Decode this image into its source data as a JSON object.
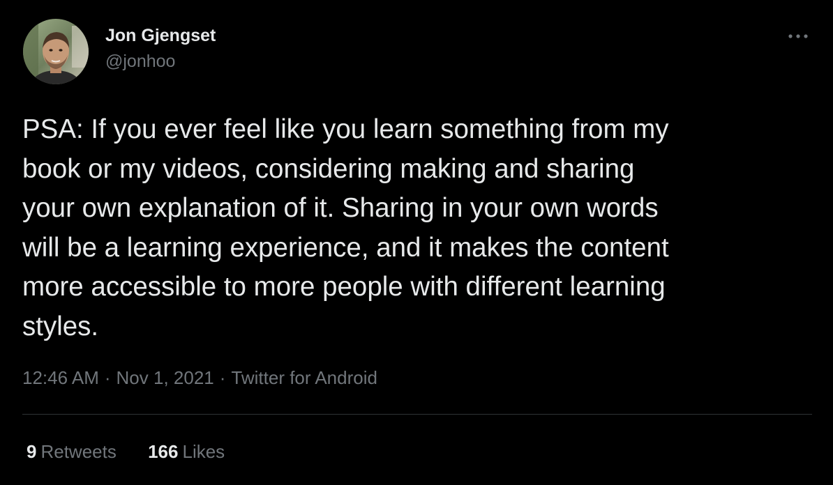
{
  "author": {
    "display_name": "Jon Gjengset",
    "handle": "@jonhoo",
    "avatar_icon": "profile-photo"
  },
  "more_icon": "ellipsis-icon",
  "tweet": {
    "text": "PSA: If you ever feel like you learn something from my\nbook or my videos, considering making and sharing\nyour own explanation of it. Sharing in your own words\nwill be a learning experience, and it makes the content\nmore accessible to more people with different learning\nstyles."
  },
  "meta": {
    "time": "12:46 AM",
    "separator": "·",
    "date": "Nov 1, 2021",
    "source": "Twitter for Android"
  },
  "stats": {
    "retweets_count": "9",
    "retweets_label": "Retweets",
    "likes_count": "166",
    "likes_label": "Likes"
  },
  "colors": {
    "background": "#000000",
    "primary_text": "#e7e9ea",
    "secondary_text": "#71767b",
    "divider": "#2f3336"
  }
}
